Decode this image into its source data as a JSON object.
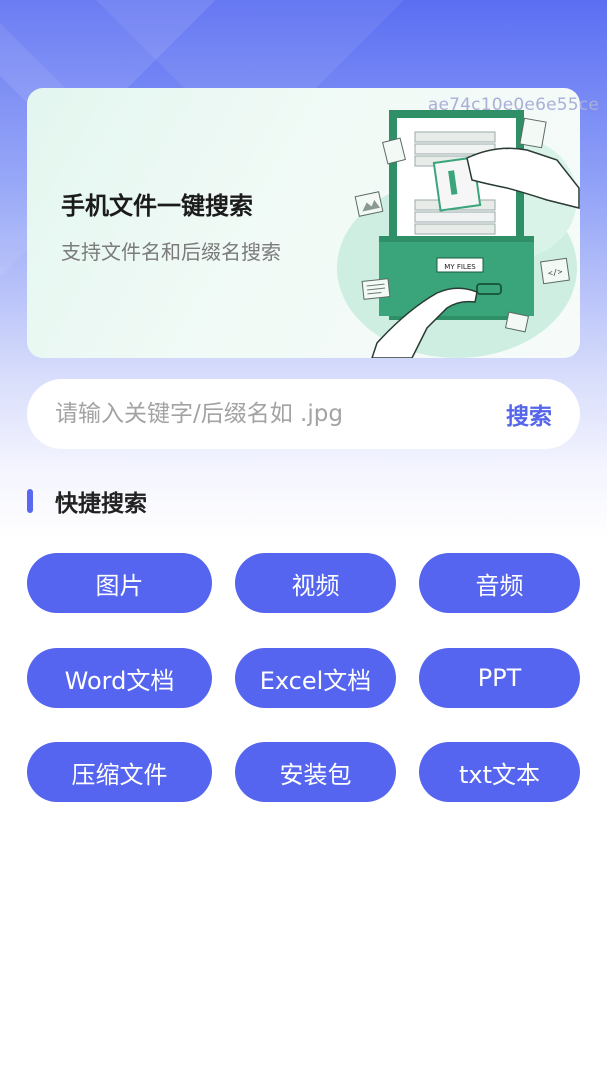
{
  "banner": {
    "id_text": "ae74c10e0e6e55ce",
    "title": "手机文件一键搜索",
    "subtitle": "支持文件名和后缀名搜索",
    "illustration_label": "MY FILES"
  },
  "search": {
    "placeholder": "请输入关键字/后缀名如 .jpg",
    "value": "",
    "button_label": "搜索"
  },
  "quick_search": {
    "title": "快捷搜索",
    "items": [
      {
        "label": "图片"
      },
      {
        "label": "视频"
      },
      {
        "label": "音频"
      },
      {
        "label": "Word文档"
      },
      {
        "label": "Excel文档"
      },
      {
        "label": "PPT"
      },
      {
        "label": "压缩文件"
      },
      {
        "label": "安装包"
      },
      {
        "label": "txt文本"
      }
    ]
  },
  "colors": {
    "accent": "#5565f0",
    "header_gradient_top": "#5b6ef2",
    "banner_bg": "#e3f6ef",
    "cabinet_green": "#3aa57a"
  }
}
